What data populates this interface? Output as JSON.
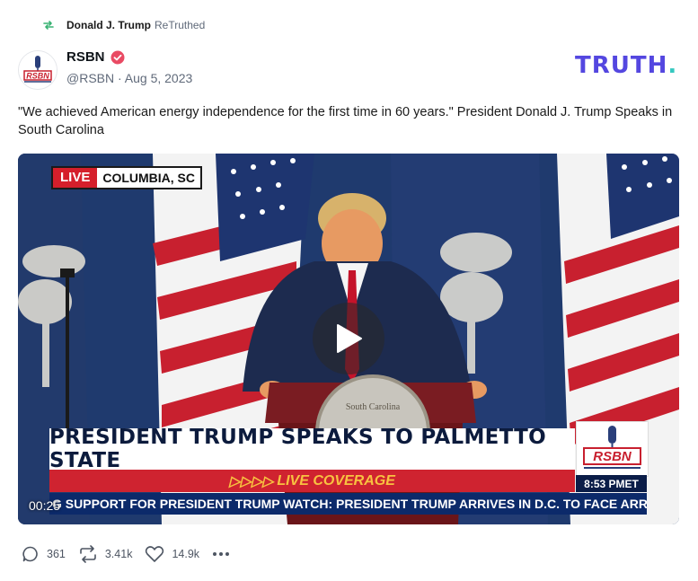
{
  "retruth": {
    "name": "Donald J. Trump",
    "tag": "ReTruthed"
  },
  "author": {
    "name": "RSBN",
    "handle": "@RSBN",
    "date": "Aug 5, 2023",
    "avatar_text": "RSBN"
  },
  "brand": {
    "logo_text": "TRUTH",
    "logo_dot": "."
  },
  "post": {
    "text": "\"We achieved American energy independence for the first time in 60 years.\" President Donald J. Trump Speaks in South Carolina"
  },
  "video": {
    "live_label": "LIVE",
    "location": "COLUMBIA, SC",
    "headline": "PRESIDENT TRUMP SPEAKS TO PALMETTO STATE",
    "subheadline": "LIVE COVERAGE",
    "subheadline_arrows": "▷▷▷▷",
    "network": "RSBN",
    "time": "8:53 PMET",
    "ticker": "G SUPPORT FOR PRESIDENT TRUMP    WATCH: PRESIDENT TRUMP ARRIVES IN D.C. TO FACE ARR",
    "timecode": "00:25",
    "seal_text": "South Carolina"
  },
  "actions": {
    "replies": "361",
    "retruths": "3.41k",
    "likes": "14.9k"
  },
  "colors": {
    "brand_purple": "#5447e0",
    "brand_teal": "#35c8c0",
    "verified": "#e94a63",
    "live_red": "#d51f2b"
  },
  "icons": [
    "retruth-icon",
    "verified-icon",
    "play-icon",
    "reply-icon",
    "retruth-action-icon",
    "heart-icon",
    "more-icon"
  ]
}
